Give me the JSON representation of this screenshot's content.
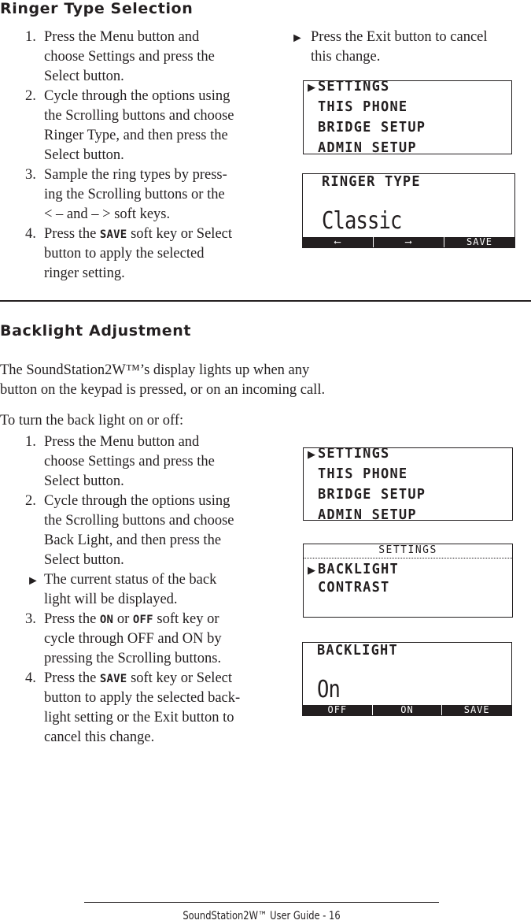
{
  "ringer_section": {
    "title": "Ringer Type Selection",
    "steps": [
      {
        "num": "1.",
        "lines": [
          "Press the Menu button and",
          "choose Settings and press the",
          "Select button."
        ]
      },
      {
        "num": "2.",
        "lines": [
          "Cycle through the options using",
          "the Scrolling buttons and choose",
          "Ringer Type, and then press the",
          "Select button."
        ]
      },
      {
        "num": "3.",
        "lines": [
          "Sample the ring types by press-",
          "ing the Scrolling buttons or the",
          "< – and – >  soft keys."
        ]
      },
      {
        "num": "4.",
        "line1_pre": "Press the ",
        "line1_key": "SAVE",
        "line1_post": " soft key or Select",
        "lines": [
          "button to apply the selected",
          "ringer setting."
        ]
      }
    ],
    "note_bullet": "►",
    "note_lines": [
      "Press the Exit button to cancel",
      "this change."
    ],
    "lcd_menu": {
      "caret": "▶",
      "items": [
        "SETTINGS",
        "THIS PHONE",
        "BRIDGE SETUP",
        "ADMIN SETUP"
      ]
    },
    "lcd_ringer": {
      "label": "RINGER TYPE",
      "value": "Classic",
      "softkeys": [
        "⟵",
        "⟶",
        "SAVE"
      ]
    }
  },
  "backlight_section": {
    "title": "Backlight Adjustment",
    "intro_lines": [
      "The SoundStation2W™’s display lights up when any",
      "button on the keypad is pressed, or on an incoming call."
    ],
    "lead": "To turn the back light on or off:",
    "steps": [
      {
        "num": "1.",
        "lines": [
          "Press the Menu button and",
          "choose Settings and press the",
          "Select button."
        ]
      },
      {
        "num": "2.",
        "lines": [
          "Cycle through the options using",
          "the Scrolling buttons and choose",
          "Back Light, and then press the",
          "Select button."
        ]
      },
      {
        "num": "►",
        "lines": [
          "The current status of the back",
          "light will be displayed."
        ]
      },
      {
        "num": "3.",
        "line1_pre": "Press the ",
        "line1_key": "ON",
        "line1_mid": " or ",
        "line1_key2": "OFF",
        "line1_post": " soft key or",
        "lines": [
          "cycle through OFF and ON by",
          "pressing the Scrolling buttons."
        ]
      },
      {
        "num": "4.",
        "line1_pre": "Press the ",
        "line1_key": "SAVE",
        "line1_post": " soft key or Select",
        "lines": [
          "button to apply the selected back-",
          "light setting or the Exit button to",
          "cancel this change."
        ]
      }
    ],
    "lcd_menu": {
      "caret": "▶",
      "items": [
        "SETTINGS",
        "THIS PHONE",
        "BRIDGE SETUP",
        "ADMIN SETUP"
      ]
    },
    "lcd_settings": {
      "header": "SETTINGS",
      "caret": "▶",
      "items": [
        "BACKLIGHT",
        "CONTRAST"
      ]
    },
    "lcd_backlight": {
      "label": "BACKLIGHT",
      "value": "On",
      "softkeys": [
        "OFF",
        "ON",
        "SAVE"
      ]
    }
  },
  "footer": {
    "text": "SoundStation2W™ User Guide - 16"
  }
}
